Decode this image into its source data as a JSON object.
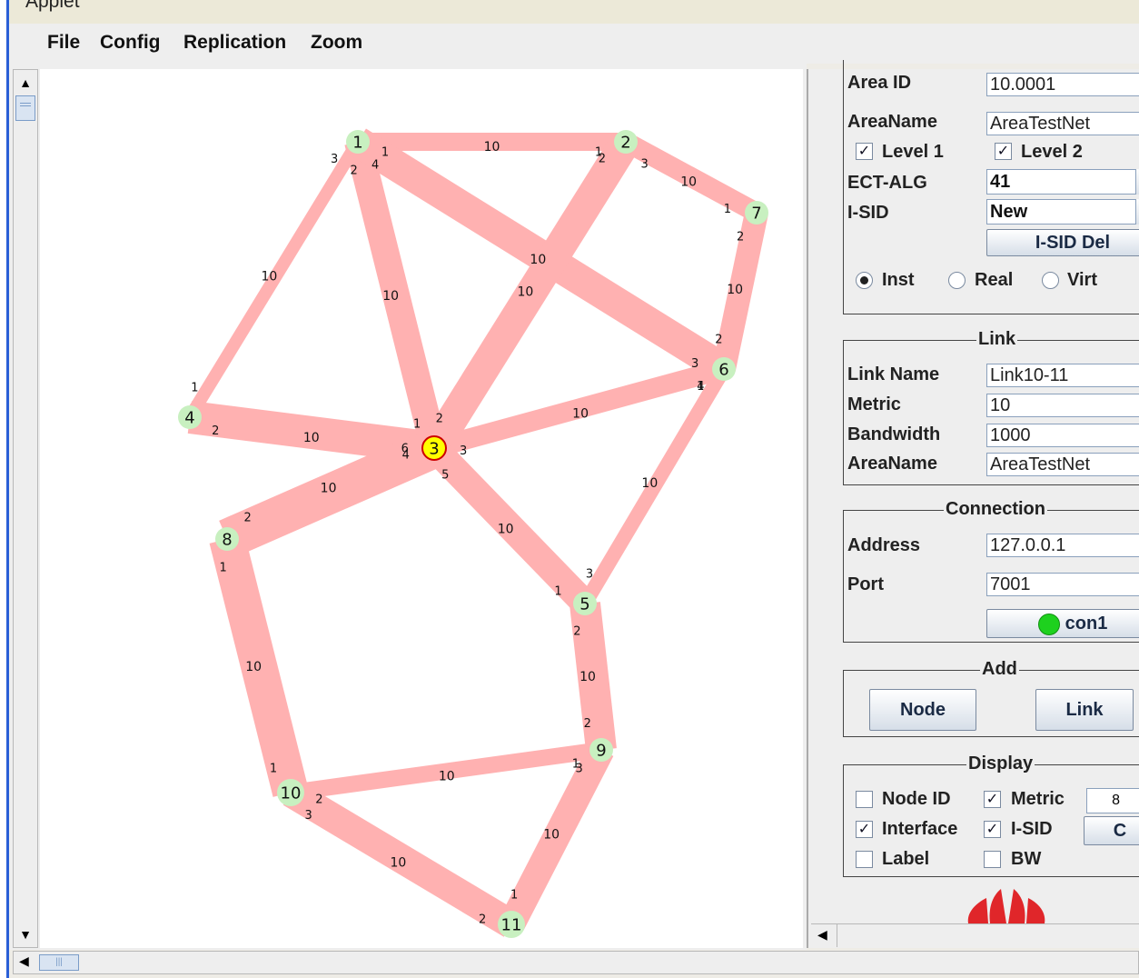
{
  "window": {
    "title": "Applet"
  },
  "menu": {
    "file": "File",
    "config": "Config",
    "replication": "Replication",
    "zoom": "Zoom"
  },
  "nodes": [
    {
      "id": "1",
      "highlighted": false
    },
    {
      "id": "2",
      "highlighted": false
    },
    {
      "id": "3",
      "highlighted": true
    },
    {
      "id": "4",
      "highlighted": false
    },
    {
      "id": "5",
      "highlighted": false
    },
    {
      "id": "6",
      "highlighted": false
    },
    {
      "id": "7",
      "highlighted": false
    },
    {
      "id": "8",
      "highlighted": false
    },
    {
      "id": "9",
      "highlighted": false
    },
    {
      "id": "10",
      "highlighted": false
    },
    {
      "id": "11",
      "highlighted": false
    }
  ],
  "links": [
    {
      "from": "1",
      "to": "2",
      "metric": "10",
      "if_from": "1",
      "if_to": "1"
    },
    {
      "from": "1",
      "to": "4",
      "metric": "10",
      "if_from": "3",
      "if_to": "1"
    },
    {
      "from": "1",
      "to": "3",
      "metric": "10",
      "if_from": "2",
      "if_to": "1"
    },
    {
      "from": "1",
      "to": "6",
      "metric": "10",
      "if_from": "4",
      "if_to": "3"
    },
    {
      "from": "2",
      "to": "7",
      "metric": "10",
      "if_from": "3",
      "if_to": "1"
    },
    {
      "from": "2",
      "to": "3",
      "metric": "10",
      "if_from": "2",
      "if_to": "2"
    },
    {
      "from": "7",
      "to": "6",
      "metric": "10",
      "if_from": "2",
      "if_to": "2"
    },
    {
      "from": "4",
      "to": "3",
      "metric": "10",
      "if_from": "2",
      "if_to": "4"
    },
    {
      "from": "3",
      "to": "6",
      "metric": "10",
      "if_from": "3",
      "if_to": "1"
    },
    {
      "from": "3",
      "to": "8",
      "metric": "10",
      "if_from": "6",
      "if_to": "2"
    },
    {
      "from": "3",
      "to": "5",
      "metric": "10",
      "if_from": "5",
      "if_to": "1"
    },
    {
      "from": "6",
      "to": "5",
      "metric": "10",
      "if_from": "4",
      "if_to": "3"
    },
    {
      "from": "8",
      "to": "10",
      "metric": "10",
      "if_from": "1",
      "if_to": "1"
    },
    {
      "from": "5",
      "to": "9",
      "metric": "10",
      "if_from": "2",
      "if_to": "2"
    },
    {
      "from": "10",
      "to": "9",
      "metric": "10",
      "if_from": "2",
      "if_to": "1"
    },
    {
      "from": "10",
      "to": "11",
      "metric": "10",
      "if_from": "3",
      "if_to": "2"
    },
    {
      "from": "9",
      "to": "11",
      "metric": "10",
      "if_from": "3",
      "if_to": "1"
    }
  ],
  "area": {
    "area_id_label": "Area ID",
    "area_id": "10.0001",
    "area_name_label": "AreaName",
    "area_name": "AreaTestNet",
    "level1_label": "Level 1",
    "level1": true,
    "level2_label": "Level 2",
    "level2": true,
    "ect_alg_label": "ECT-ALG",
    "ect_alg": "41",
    "isid_label": "I-SID",
    "isid": "New",
    "isid_del_label": "I-SID Del",
    "inst_label": "Inst",
    "real_label": "Real",
    "virt_label": "Virt",
    "selected_mode": "Inst"
  },
  "link": {
    "title": "Link",
    "name_label": "Link Name",
    "name": "Link10-11",
    "metric_label": "Metric",
    "metric": "10",
    "bandwidth_label": "Bandwidth",
    "bandwidth": "1000",
    "area_name_label": "AreaName",
    "area_name": "AreaTestNet"
  },
  "connection": {
    "title": "Connection",
    "address_label": "Address",
    "address": "127.0.0.1",
    "port_label": "Port",
    "port": "7001",
    "connect_label": "con1",
    "status_color": "#1ed11e"
  },
  "add": {
    "title": "Add",
    "node_label": "Node",
    "link_label": "Link"
  },
  "display": {
    "title": "Display",
    "node_id_label": "Node ID",
    "node_id": false,
    "metric_label": "Metric",
    "metric": true,
    "interface_label": "Interface",
    "interface": true,
    "isid_label": "I-SID",
    "isid": true,
    "label_label": "Label",
    "label": false,
    "bw_label": "BW",
    "bw": false,
    "font_size": "8",
    "c_label": "C"
  },
  "colors": {
    "link": "#ffb1b1",
    "node": "#c8f0c0",
    "selected_node": "#ffff00"
  }
}
